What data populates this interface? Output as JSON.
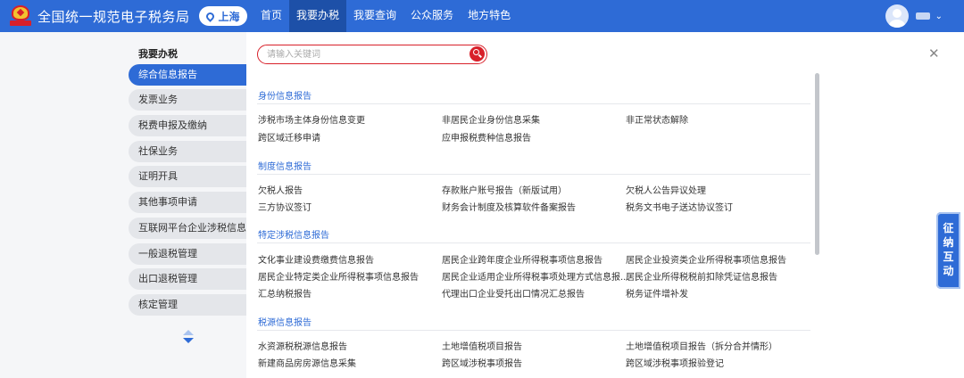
{
  "header": {
    "site_title": "全国统一规范电子税务局",
    "region": "上海",
    "nav": [
      "首页",
      "我要办税",
      "我要查询",
      "公众服务",
      "地方特色"
    ],
    "active_nav_index": 1
  },
  "sidebar": {
    "heading": "我要办税",
    "items": [
      "综合信息报告",
      "发票业务",
      "税费申报及缴纳",
      "社保业务",
      "证明开具",
      "其他事项申请",
      "互联网平台企业涉税信息报送",
      "一般退税管理",
      "出口退税管理",
      "核定管理"
    ],
    "active_index": 0
  },
  "search": {
    "placeholder": "请输入关键词",
    "value": ""
  },
  "sections": [
    {
      "title": "身份信息报告",
      "links": [
        "涉税市场主体身份信息变更",
        "非居民企业身份信息采集",
        "非正常状态解除",
        "跨区域迁移申请",
        "应申报税费种信息报告"
      ]
    },
    {
      "title": "制度信息报告",
      "links": [
        "欠税人报告",
        "存款账户账号报告（新版试用）",
        "欠税人公告异议处理",
        "三方协议签订",
        "财务会计制度及核算软件备案报告",
        "税务文书电子送达协议签订"
      ]
    },
    {
      "title": "特定涉税信息报告",
      "links": [
        "文化事业建设费缴费信息报告",
        "居民企业跨年度企业所得税事项信息报告",
        "居民企业投资类企业所得税事项信息报告",
        "居民企业特定类企业所得税事项信息报告",
        "居民企业适用企业所得税事项处理方式信息报...",
        "居民企业所得税税前扣除凭证信息报告",
        "汇总纳税报告",
        "代理出口企业受托出口情况汇总报告",
        "税务证件增补发"
      ]
    },
    {
      "title": "税源信息报告",
      "links": [
        "水资源税税源信息报告",
        "土地增值税项目报告",
        "土地增值税项目报告（拆分合并情形）",
        "新建商品房房源信息采集",
        "跨区域涉税事项报告",
        "跨区域涉税事项报验登记"
      ]
    }
  ],
  "float_tab": "征纳互动",
  "colors": {
    "primary": "#2e6bd6",
    "nav_active": "#1d50a8",
    "search_border": "#d8202a",
    "section_title": "#2e6bd6"
  }
}
